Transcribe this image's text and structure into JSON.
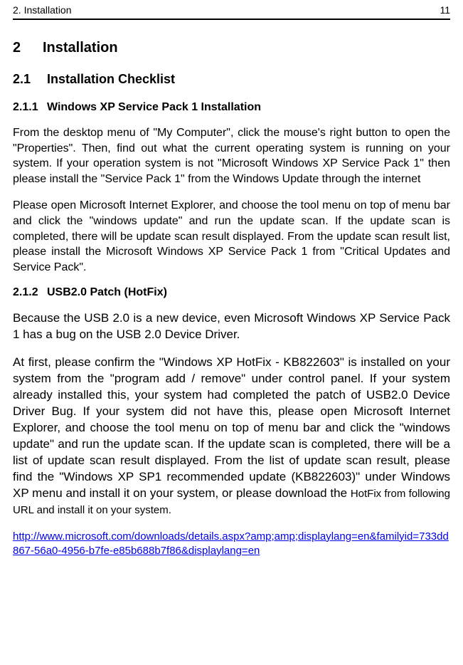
{
  "header": {
    "left": "2. Installation",
    "right": "11"
  },
  "h1": {
    "num": "2",
    "title": "Installation"
  },
  "h2_1": {
    "num": "2.1",
    "title": "Installation Checklist"
  },
  "h3_1": {
    "num": "2.1.1",
    "title": "Windows XP Service Pack 1 Installation"
  },
  "p1": "From the desktop menu of \"My Computer\", click the mouse's right button to open the \"Properties\".   Then, find out what the current operating system is running on your system. If your operation system is not \"Microsoft Windows XP Service Pack 1\" then please install the \"Service Pack 1\" from the Windows Update through the internet",
  "p2": "Please open Microsoft Internet Explorer, and choose the tool menu on top of menu bar and click the \"windows update\" and run the update scan.   If the update scan is completed, there will be update scan result displayed. From the update scan result list, please install the Microsoft Windows XP Service Pack 1 from \"Critical Updates and Service Pack\".",
  "h3_2": {
    "num": "2.1.2",
    "title": "USB2.0 Patch (HotFix)"
  },
  "p3": "Because the USB 2.0 is a new device, even Microsoft Windows XP Service Pack 1 has a bug on the USB 2.0 Device Driver.",
  "p4_main": "At first, please confirm the \"Windows XP HotFix - KB822603\" is installed on your system from the \"program add / remove\" under control panel.   If your system already installed this, your system had completed the patch of USB2.0 Device Driver Bug. If your system did not have this, please open Microsoft Internet Explorer, and choose the tool menu on top of menu bar and click the \"windows update\" and run the update scan.   If the update scan is completed, there will be a list of update scan result displayed. From the list of update scan result, please find the \"Windows XP SP1 recommended update (KB822603)\" under Windows XP menu and install it on your system, or please download the ",
  "p4_tail_a": "HotFix from",
  "p4_tail_b": " following URL and install it on your system.",
  "url": "http://www.microsoft.com/downloads/details.aspx?amp;amp;displaylang=en&familyid=733dd867-56a0-4956-b7fe-e85b688b7f86&displaylang=en"
}
